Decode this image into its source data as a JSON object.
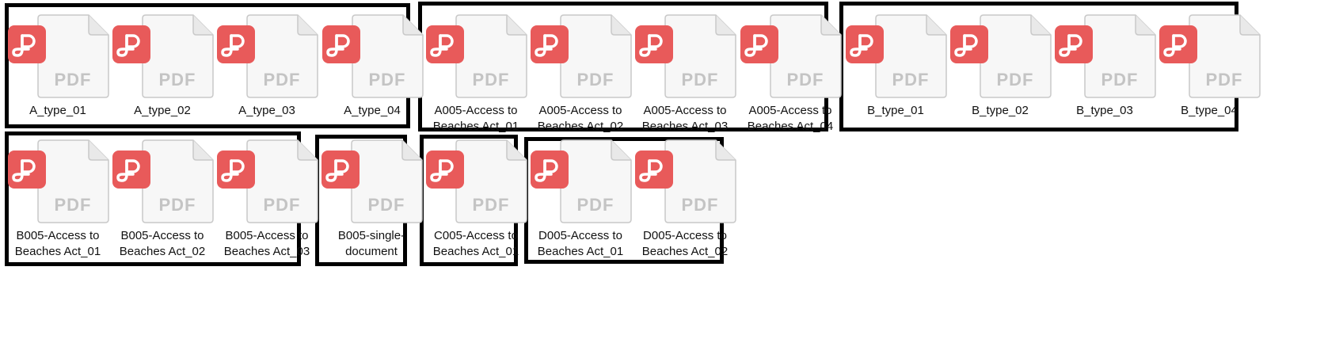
{
  "colors": {
    "badge": "#e85a5a",
    "doc_fill": "#f7f7f7",
    "doc_stroke": "#c9c9c9",
    "doc_text": "#c4c4c4",
    "group_border": "#000000"
  },
  "icon_names": {
    "file_icon": "pdf-file-icon",
    "badge": "pdf-logo-icon"
  },
  "doc_text": "PDF",
  "groups": [
    {
      "name": "group-a-type",
      "files": [
        {
          "label": "A_type_01"
        },
        {
          "label": "A_type_02"
        },
        {
          "label": "A_type_03"
        },
        {
          "label": "A_type_04"
        }
      ]
    },
    {
      "name": "group-a005",
      "files": [
        {
          "label": "A005-Access to Beaches Act_01"
        },
        {
          "label": "A005-Access to Beaches Act_02"
        },
        {
          "label": "A005-Access to Beaches Act_03"
        },
        {
          "label": "A005-Access to Beaches Act_04"
        }
      ]
    },
    {
      "name": "group-b-type",
      "files": [
        {
          "label": "B_type_01"
        },
        {
          "label": "B_type_02"
        },
        {
          "label": "B_type_03"
        },
        {
          "label": "B_type_04"
        }
      ]
    },
    {
      "name": "group-b005",
      "files": [
        {
          "label": "B005-Access to Beaches Act_01"
        },
        {
          "label": "B005-Access to Beaches Act_02"
        },
        {
          "label": "B005-Access to Beaches Act_03"
        }
      ]
    },
    {
      "name": "group-b005-single",
      "files": [
        {
          "label": "B005-single-document"
        }
      ]
    },
    {
      "name": "group-c005",
      "files": [
        {
          "label": "C005-Access to Beaches Act_01"
        }
      ]
    },
    {
      "name": "group-d005",
      "files": [
        {
          "label": "D005-Access to Beaches Act_01"
        },
        {
          "label": "D005-Access to Beaches Act_02"
        }
      ]
    }
  ]
}
